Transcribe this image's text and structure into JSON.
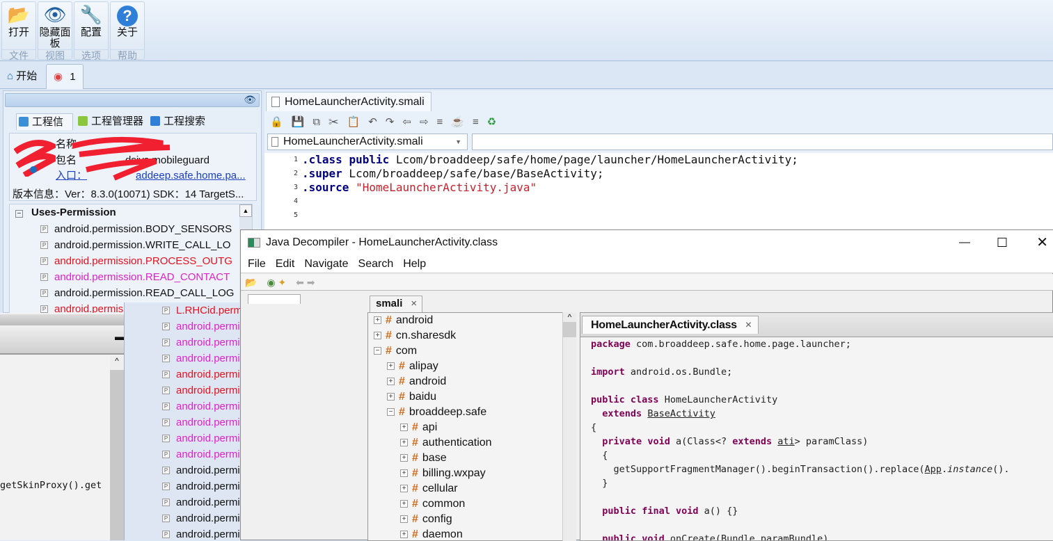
{
  "ribbon": {
    "buttons": [
      {
        "label": "打开",
        "group": "文件",
        "icon": "folder-open-icon"
      },
      {
        "label": "隐藏面板",
        "group": "视图",
        "icon": "eye-icon"
      },
      {
        "label": "配置",
        "group": "选项",
        "icon": "tools-icon"
      },
      {
        "label": "关于",
        "group": "帮助",
        "icon": "help-icon"
      }
    ]
  },
  "tabs": [
    {
      "label": "开始",
      "icon": "home-icon"
    },
    {
      "label": "1",
      "icon": "project-icon"
    }
  ],
  "left_panel": {
    "tabs": [
      "工程信息",
      "工程管理器",
      "工程搜索"
    ],
    "info": {
      "name_label": "名称",
      "package_label": "包名",
      "package_value": "dsivs.mobileguard",
      "entry_label": "入口：",
      "entry_value": "addeep.safe.home.pa...",
      "version": "版本信息：Ver：8.3.0(10071) SDK：14 TargetS..."
    },
    "perm_header": "Uses-Permission",
    "permissions": [
      {
        "name": "android.permission.BODY_SENSORS",
        "level": "normal"
      },
      {
        "name": "android.permission.WRITE_CALL_LO",
        "level": "normal"
      },
      {
        "name": "android.permission.PROCESS_OUTG",
        "level": "danger"
      },
      {
        "name": "android.permission.READ_CONTACT",
        "level": "sensitive"
      },
      {
        "name": "android.permission.READ_CALL_LOG",
        "level": "normal"
      },
      {
        "name": "android.permission.CAL",
        "level": "danger"
      }
    ]
  },
  "permissions_overlay": [
    {
      "name": "L.RHCid.permission.CALL_PHONE",
      "level": "danger"
    },
    {
      "name": "android.permission.READ_PHONE_ST",
      "level": "sensitive"
    },
    {
      "name": "android.permission.WRITE_CONTAC",
      "level": "sensitive"
    },
    {
      "name": "android.permission.RECEIVE_SMS",
      "level": "sensitive"
    },
    {
      "name": "android.permission.READ_SMS",
      "level": "danger"
    },
    {
      "name": "android.permission.SEND_SMS",
      "level": "danger"
    },
    {
      "name": "android.permission.WRITE_SMS",
      "level": "sensitive"
    },
    {
      "name": "android.permission.RECEIVE_MMS",
      "level": "sensitive"
    },
    {
      "name": "android.permission.RECEIVE_WAP_PU",
      "level": "sensitive"
    },
    {
      "name": "android.permission.RECORD_AUDIO",
      "level": "sensitive"
    },
    {
      "name": "android.permission.READ_EXTERNAL",
      "level": "normal"
    },
    {
      "name": "android.permission.MOUNT_UNMOU",
      "level": "normal"
    },
    {
      "name": "android.permission.KILL_BACKGROU",
      "level": "normal"
    },
    {
      "name": "android.permission.GET_PACKAGE_S",
      "level": "normal"
    },
    {
      "name": "android.permission.CLEAR_APP_CAC",
      "level": "normal"
    }
  ],
  "colors": {
    "danger": "#e8101c",
    "sensitive": "#e020d0",
    "normal": "#111111",
    "keyword": "#7f0055"
  },
  "bottom_left_code": "getSkinProxy().get",
  "editor": {
    "tab": "HomeLauncherActivity.smali",
    "combo_value": "HomeLauncherActivity.smali",
    "lines": [
      {
        "n": "1",
        "tokens": [
          {
            "t": ".class",
            "c": "k1"
          },
          {
            "t": " "
          },
          {
            "t": "public",
            "c": "k1"
          },
          {
            "t": " Lcom/broaddeep/safe/home/page/launcher/HomeLauncherActivity;"
          }
        ]
      },
      {
        "n": "2",
        "tokens": [
          {
            "t": ".super",
            "c": "k1"
          },
          {
            "t": " Lcom/broaddeep/safe/base/BaseActivity;"
          }
        ]
      },
      {
        "n": "3",
        "tokens": [
          {
            "t": ".source",
            "c": "k1"
          },
          {
            "t": " "
          },
          {
            "t": "\"HomeLauncherActivity.java\"",
            "c": "str"
          }
        ]
      },
      {
        "n": "4",
        "tokens": []
      },
      {
        "n": "5",
        "tokens": []
      }
    ]
  },
  "jd": {
    "title": "Java Decompiler - HomeLauncherActivity.class",
    "menu": [
      "File",
      "Edit",
      "Navigate",
      "Search",
      "Help"
    ],
    "tree_tab": "smali",
    "tree": [
      {
        "label": "android",
        "depth": 0,
        "expanded": false
      },
      {
        "label": "cn.sharesdk",
        "depth": 0,
        "expanded": false
      },
      {
        "label": "com",
        "depth": 0,
        "expanded": true
      },
      {
        "label": "alipay",
        "depth": 1,
        "expanded": false
      },
      {
        "label": "android",
        "depth": 1,
        "expanded": false
      },
      {
        "label": "baidu",
        "depth": 1,
        "expanded": false
      },
      {
        "label": "broaddeep.safe",
        "depth": 1,
        "expanded": true
      },
      {
        "label": "api",
        "depth": 2,
        "expanded": false
      },
      {
        "label": "authentication",
        "depth": 2,
        "expanded": false
      },
      {
        "label": "base",
        "depth": 2,
        "expanded": false
      },
      {
        "label": "billing.wxpay",
        "depth": 2,
        "expanded": false
      },
      {
        "label": "cellular",
        "depth": 2,
        "expanded": false
      },
      {
        "label": "common",
        "depth": 2,
        "expanded": false
      },
      {
        "label": "config",
        "depth": 2,
        "expanded": false
      },
      {
        "label": "daemon",
        "depth": 2,
        "expanded": false
      }
    ],
    "code_tab": "HomeLauncherActivity.class",
    "code": [
      [
        {
          "t": "package",
          "c": "kw"
        },
        {
          "t": " com.broaddeep.safe.home.page.launcher;"
        }
      ],
      [],
      [
        {
          "t": "import",
          "c": "kw"
        },
        {
          "t": " android.os.Bundle;"
        }
      ],
      [],
      [
        {
          "t": "public",
          "c": "kw"
        },
        {
          "t": " "
        },
        {
          "t": "class",
          "c": "kw"
        },
        {
          "t": " HomeLauncherActivity"
        }
      ],
      [
        {
          "t": "  "
        },
        {
          "t": "extends",
          "c": "kw"
        },
        {
          "t": " "
        },
        {
          "t": "BaseActivity",
          "c": "ul"
        }
      ],
      [
        {
          "t": "{"
        }
      ],
      [
        {
          "t": "  "
        },
        {
          "t": "private",
          "c": "kw"
        },
        {
          "t": " "
        },
        {
          "t": "void",
          "c": "kw"
        },
        {
          "t": " a(Class<? "
        },
        {
          "t": "extends",
          "c": "kw"
        },
        {
          "t": " "
        },
        {
          "t": "ati",
          "c": "ul"
        },
        {
          "t": "> paramClass)"
        }
      ],
      [
        {
          "t": "  {"
        }
      ],
      [
        {
          "t": "    getSupportFragmentManager().beginTransaction().replace("
        },
        {
          "t": "App",
          "c": "ul"
        },
        {
          "t": "."
        },
        {
          "t": "instance",
          "c": "it"
        },
        {
          "t": "()."
        }
      ],
      [
        {
          "t": "  }"
        }
      ],
      [],
      [
        {
          "t": "  "
        },
        {
          "t": "public",
          "c": "kw"
        },
        {
          "t": " "
        },
        {
          "t": "final",
          "c": "kw"
        },
        {
          "t": " "
        },
        {
          "t": "void",
          "c": "kw"
        },
        {
          "t": " a() {}"
        }
      ],
      [],
      [
        {
          "t": "  "
        },
        {
          "t": "public",
          "c": "kw"
        },
        {
          "t": " "
        },
        {
          "t": "void",
          "c": "kw"
        },
        {
          "t": " onCreate(Bundle paramBundle)"
        }
      ]
    ]
  }
}
